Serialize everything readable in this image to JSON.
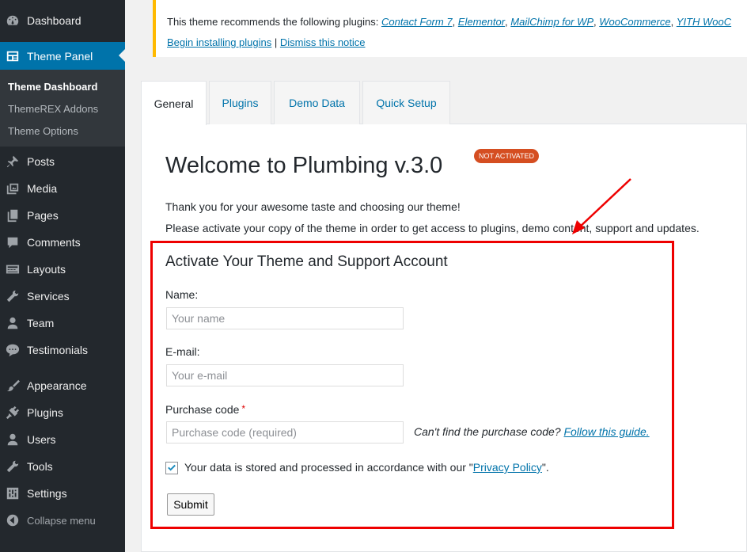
{
  "sidebar": {
    "items": [
      {
        "label": "Dashboard",
        "icon": "dashboard-icon"
      },
      {
        "label": "Theme Panel",
        "icon": "theme-panel-icon"
      },
      {
        "label": "Posts",
        "icon": "pin-icon"
      },
      {
        "label": "Media",
        "icon": "media-icon"
      },
      {
        "label": "Pages",
        "icon": "pages-icon"
      },
      {
        "label": "Comments",
        "icon": "comment-icon"
      },
      {
        "label": "Layouts",
        "icon": "layouts-icon"
      },
      {
        "label": "Services",
        "icon": "wrench-icon"
      },
      {
        "label": "Team",
        "icon": "user-icon"
      },
      {
        "label": "Testimonials",
        "icon": "testimonials-icon"
      },
      {
        "label": "Appearance",
        "icon": "brush-icon"
      },
      {
        "label": "Plugins",
        "icon": "plugin-icon"
      },
      {
        "label": "Users",
        "icon": "users-icon"
      },
      {
        "label": "Tools",
        "icon": "tools-icon"
      },
      {
        "label": "Settings",
        "icon": "settings-icon"
      },
      {
        "label": "Collapse menu",
        "icon": "collapse-icon"
      }
    ],
    "submenu": [
      "Theme Dashboard",
      "ThemeREX Addons",
      "Theme Options"
    ]
  },
  "notice": {
    "prefix": "This theme recommends the following plugins: ",
    "plugins": [
      "Contact Form 7",
      "Elementor",
      "MailChimp for WP",
      "WooCommerce",
      "YITH WooC"
    ],
    "sep": ", ",
    "begin": "Begin installing plugins",
    "divider": " | ",
    "dismiss": "Dismiss this notice"
  },
  "tabs": [
    "General",
    "Plugins",
    "Demo Data",
    "Quick Setup"
  ],
  "welcome": {
    "title": "Welcome to Plumbing v.3.0",
    "badge": "Not activated",
    "line1": "Thank you for your awesome taste and choosing our theme!",
    "line2": "Please activate your copy of the theme in order to get access to plugins, demo content, support and updates."
  },
  "form": {
    "title": "Activate Your Theme and Support Account",
    "name_label": "Name:",
    "name_placeholder": "Your name",
    "email_label": "E-mail:",
    "email_placeholder": "Your e-mail",
    "code_label": "Purchase code",
    "code_required": "*",
    "code_placeholder": "Purchase code (required)",
    "hint_text": "Can't find the purchase code? ",
    "hint_link": "Follow this guide.",
    "consent_prefix": "Your data is stored and processed in accordance with our \"",
    "consent_link": "Privacy Policy",
    "consent_suffix": "\".",
    "submit": "Submit"
  },
  "colors": {
    "accent": "#0073aa",
    "sidebar": "#23282d",
    "highlight": "#e00000",
    "badge": "#d54e21",
    "notice": "#ffb900"
  }
}
